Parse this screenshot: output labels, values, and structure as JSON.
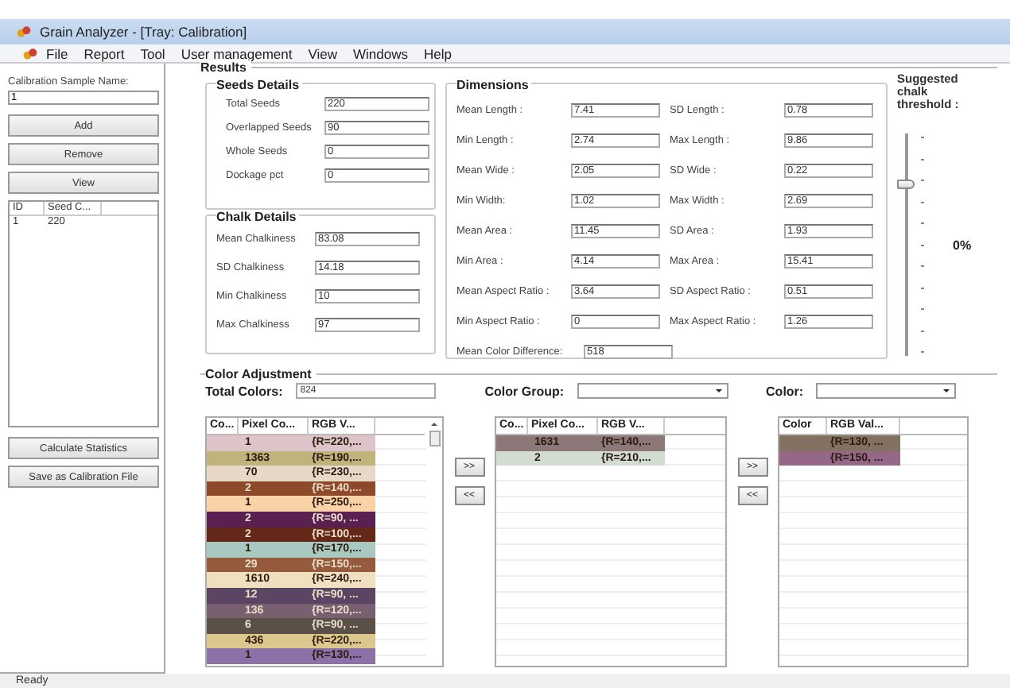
{
  "window": {
    "title": "Grain Analyzer - [Tray: Calibration]"
  },
  "menu": [
    "File",
    "Report",
    "Tool",
    "User management",
    "View",
    "Windows",
    "Help"
  ],
  "sidebar": {
    "sample_label": "Calibration Sample Name:",
    "sample_value": "1",
    "buttons": [
      "Add",
      "Remove",
      "View"
    ],
    "list": {
      "columns": [
        "ID",
        "Seed C..."
      ],
      "rows": [
        [
          "1",
          "220"
        ]
      ]
    },
    "bottom_buttons": [
      "Calculate Statistics",
      "Save as Calibration File"
    ]
  },
  "results": {
    "title": "Results",
    "seeds": {
      "title": "Seeds Details",
      "fields": [
        {
          "label": "Total Seeds",
          "value": "220"
        },
        {
          "label": "Overlapped Seeds",
          "value": "90"
        },
        {
          "label": "Whole Seeds",
          "value": "0"
        },
        {
          "label": "Dockage  pct",
          "value": "0"
        }
      ]
    },
    "chalk": {
      "title": "Chalk Details",
      "fields": [
        {
          "label": "Mean Chalkiness",
          "value": "83.08"
        },
        {
          "label": "SD Chalkiness",
          "value": "14.18"
        },
        {
          "label": "Min Chalkiness",
          "value": "10"
        },
        {
          "label": "Max Chalkiness",
          "value": "97"
        }
      ]
    },
    "dimensions": {
      "title": "Dimensions",
      "fields": [
        {
          "label": "Mean Length :",
          "value": "7.41"
        },
        {
          "label": "SD Length :",
          "value": "0.78"
        },
        {
          "label": "Min Length :",
          "value": "2.74"
        },
        {
          "label": "Max Length :",
          "value": "9.86"
        },
        {
          "label": "Mean Wide :",
          "value": "2.05"
        },
        {
          "label": "SD Wide :",
          "value": "0.22"
        },
        {
          "label": "Min Width:",
          "value": "1.02"
        },
        {
          "label": "Max Width :",
          "value": "2.69"
        },
        {
          "label": "Mean Area :",
          "value": "11.45"
        },
        {
          "label": "SD Area :",
          "value": "1.93"
        },
        {
          "label": "Min Area :",
          "value": "4.14"
        },
        {
          "label": "Max Area :",
          "value": "15.41"
        },
        {
          "label": "Mean Aspect Ratio :",
          "value": "3.64"
        },
        {
          "label": "SD Aspect Ratio :",
          "value": "0.51"
        },
        {
          "label": "Min Aspect Ratio :",
          "value": "0"
        },
        {
          "label": "Max Aspect Ratio :",
          "value": "1.26"
        },
        {
          "label": "Mean Color Difference:",
          "value": "518"
        }
      ]
    },
    "threshold": {
      "label": "Suggested chalk threshold :",
      "level": 0.77,
      "reading": "0%"
    }
  },
  "color_adjustment": {
    "title": "Color Adjustment",
    "total_label": "Total Colors:",
    "total_value": "824",
    "group_label": "Color Group:",
    "color_label": "Color:",
    "source_list": {
      "columns": [
        "Co...",
        "Pixel Co...",
        "RGB V..."
      ],
      "rows": [
        {
          "count": "1",
          "rgb": "{R=220,...",
          "color": "#dcc4c8"
        },
        {
          "count": "1363",
          "rgb": "{R=190,...",
          "color": "#c0b47c"
        },
        {
          "count": "70",
          "rgb": "{R=230,...",
          "color": "#e8d8c8"
        },
        {
          "count": "2",
          "rgb": "{R=140,...",
          "color": "#8c4a2a"
        },
        {
          "count": "1",
          "rgb": "{R=250,...",
          "color": "#fad2a8"
        },
        {
          "count": "2",
          "rgb": "{R=90, ...",
          "color": "#5a2050"
        },
        {
          "count": "2",
          "rgb": "{R=100,...",
          "color": "#642818"
        },
        {
          "count": "1",
          "rgb": "{R=170,...",
          "color": "#a8c8c0"
        },
        {
          "count": "29",
          "rgb": "{R=150,...",
          "color": "#965a3c"
        },
        {
          "count": "1610",
          "rgb": "{R=240,...",
          "color": "#f0e0c0"
        },
        {
          "count": "12",
          "rgb": "{R=90, ...",
          "color": "#5a4662"
        },
        {
          "count": "136",
          "rgb": "{R=120,...",
          "color": "#786070"
        },
        {
          "count": "6",
          "rgb": "{R=90, ...",
          "color": "#5a5048"
        },
        {
          "count": "436",
          "rgb": "{R=220,...",
          "color": "#dcc88c"
        },
        {
          "count": "1",
          "rgb": "{R=130,...",
          "color": "#8c70a8"
        }
      ]
    },
    "group_list": {
      "columns": [
        "Co...",
        "Pixel Co...",
        "RGB V..."
      ],
      "rows": [
        {
          "count": "1631",
          "rgb": "{R=140,...",
          "color": "#8c7878"
        },
        {
          "count": "2",
          "rgb": "{R=210,...",
          "color": "#d2dcd0"
        }
      ]
    },
    "color_list": {
      "columns": [
        "Color",
        "RGB Val..."
      ],
      "rows": [
        {
          "rgb": "{R=130, ...",
          "color": "#827060"
        },
        {
          "rgb": "{R=150, ...",
          "color": "#966888"
        }
      ]
    },
    "move_buttons": [
      ">>",
      "<<",
      ">>",
      "<<"
    ]
  },
  "status_bar": "Ready"
}
